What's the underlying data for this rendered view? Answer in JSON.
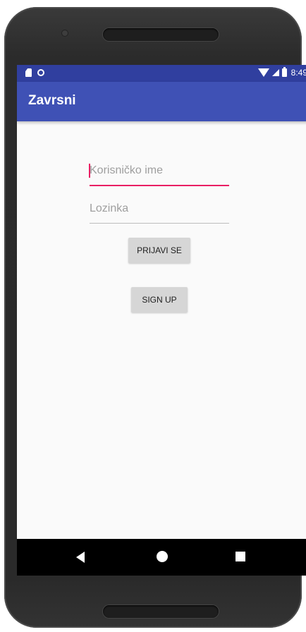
{
  "status_bar": {
    "time": "8:49",
    "color": "#303f9f"
  },
  "app_bar": {
    "title": "Zavrsni",
    "color": "#3f51b5"
  },
  "form": {
    "username": {
      "value": "",
      "placeholder": "Korisničko ime",
      "accent": "#e91e63"
    },
    "password": {
      "value": "",
      "placeholder": "Lozinka"
    },
    "login_label": "PRIJAVI SE",
    "signup_label": "SIGN UP"
  },
  "nav_bar": {
    "icons": [
      "back-icon",
      "home-icon",
      "recents-icon"
    ]
  }
}
